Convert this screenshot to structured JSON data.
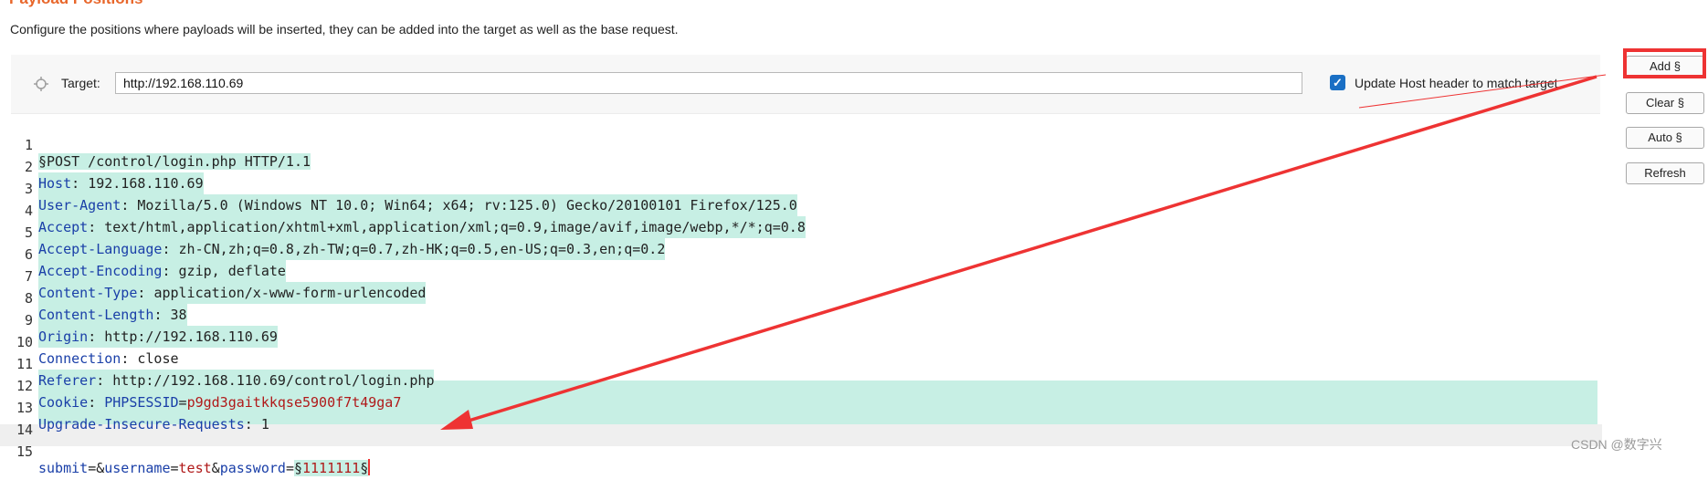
{
  "section": {
    "title": "Payload Positions",
    "description": "Configure the positions where payloads will be inserted, they can be added into the target as well as the base request."
  },
  "target": {
    "label": "Target:",
    "value": "http://192.168.110.69",
    "update_host_label": "Update Host header to match target",
    "update_host_checked": true
  },
  "buttons": {
    "add": "Add §",
    "clear": "Clear §",
    "auto": "Auto §",
    "refresh": "Refresh"
  },
  "request": {
    "lines": [
      {
        "n": "1",
        "key": "",
        "sep": "",
        "val": "§POST /control/login.php HTTP/1.1"
      },
      {
        "n": "2",
        "key": "Host",
        "sep": ": ",
        "val": "192.168.110.69"
      },
      {
        "n": "3",
        "key": "User-Agent",
        "sep": ": ",
        "val": "Mozilla/5.0 (Windows NT 10.0; Win64; x64; rv:125.0) Gecko/20100101 Firefox/125.0"
      },
      {
        "n": "4",
        "key": "Accept",
        "sep": ": ",
        "val": "text/html,application/xhtml+xml,application/xml;q=0.9,image/avif,image/webp,*/*;q=0.8"
      },
      {
        "n": "5",
        "key": "Accept-Language",
        "sep": ": ",
        "val": "zh-CN,zh;q=0.8,zh-TW;q=0.7,zh-HK;q=0.5,en-US;q=0.3,en;q=0.2"
      },
      {
        "n": "6",
        "key": "Accept-Encoding",
        "sep": ": ",
        "val": "gzip, deflate"
      },
      {
        "n": "7",
        "key": "Content-Type",
        "sep": ": ",
        "val": "application/x-www-form-urlencoded"
      },
      {
        "n": "8",
        "key": "Content-Length",
        "sep": ": ",
        "val": "38"
      },
      {
        "n": "9",
        "key": "Origin",
        "sep": ": ",
        "val": "http://192.168.110.69"
      },
      {
        "n": "10",
        "key": "Connection",
        "sep": ": ",
        "val": "close"
      },
      {
        "n": "11",
        "key": "Referer",
        "sep": ": ",
        "val": "http://192.168.110.69/control/login.php"
      },
      {
        "n": "12",
        "key": "Cookie",
        "sep": ": ",
        "ck": "PHPSESSID",
        "ceq": "=",
        "val": "p9gd3gaitkkqse5900f7t49ga7"
      },
      {
        "n": "13",
        "key": "Upgrade-Insecure-Requests",
        "sep": ": ",
        "val": "1"
      },
      {
        "n": "14",
        "key": "",
        "sep": "",
        "val": ""
      },
      {
        "n": "15",
        "p1k": "submit",
        "p1e": "=&",
        "p2k": "username",
        "p2e": "=",
        "p2v": "test",
        "amp": "&",
        "p3k": "password",
        "p3e": "=",
        "s1": "§",
        "pv": "1111111",
        "s2": "§"
      }
    ]
  },
  "watermark": "CSDN @数字兴",
  "colors": {
    "highlight": "#c7efe4",
    "annotation": "#e33333",
    "accent": "#e8662a"
  }
}
